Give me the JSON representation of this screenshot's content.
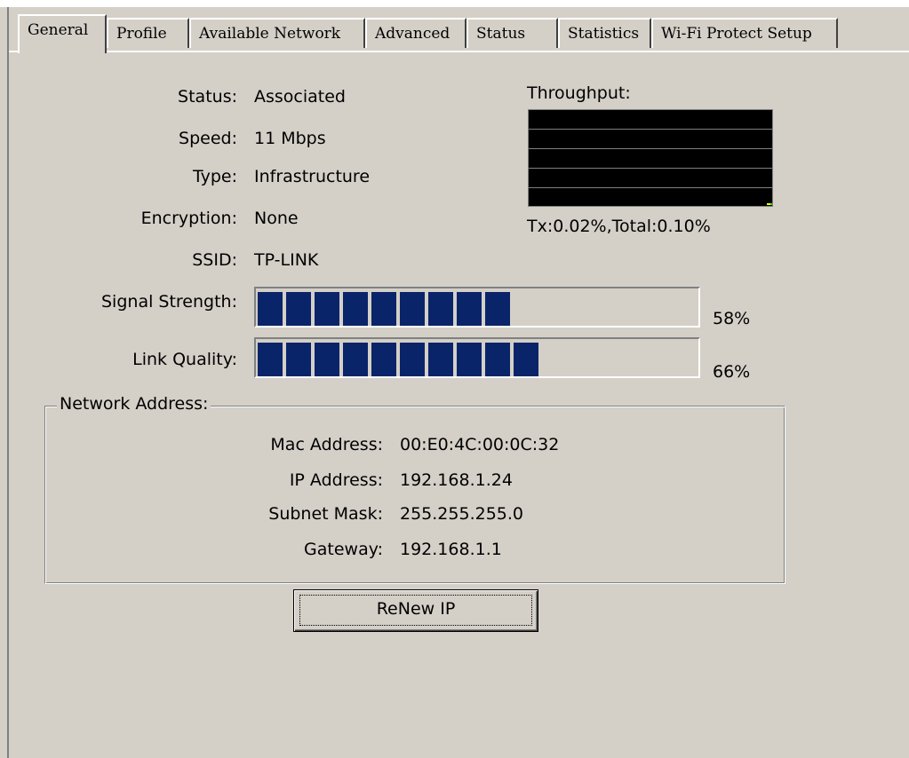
{
  "tabs": [
    {
      "label": "General",
      "active": true
    },
    {
      "label": "Profile",
      "active": false
    },
    {
      "label": "Available Network",
      "active": false
    },
    {
      "label": "Advanced",
      "active": false
    },
    {
      "label": "Status",
      "active": false
    },
    {
      "label": "Statistics",
      "active": false
    },
    {
      "label": "Wi-Fi Protect Setup",
      "active": false
    }
  ],
  "general": {
    "status": {
      "label": "Status:",
      "value": "Associated"
    },
    "speed": {
      "label": "Speed:",
      "value": "11 Mbps"
    },
    "type": {
      "label": "Type:",
      "value": "Infrastructure"
    },
    "encryption": {
      "label": "Encryption:",
      "value": "None"
    },
    "ssid": {
      "label": "SSID:",
      "value": "TP-LINK"
    }
  },
  "throughput": {
    "label": "Throughput:",
    "summary": "Tx:0.02%,Total:0.10%"
  },
  "signal_strength": {
    "label": "Signal Strength:",
    "percent_text": "58%",
    "level": 0.58,
    "bar_color": "#0a246a"
  },
  "link_quality": {
    "label": "Link Quality:",
    "percent_text": "66%",
    "level": 0.66,
    "bar_color": "#0a246a"
  },
  "network_address": {
    "legend": "Network Address:",
    "mac": {
      "label": "Mac Address:",
      "value": "00:E0:4C:00:0C:32"
    },
    "ip": {
      "label": "IP Address:",
      "value": "192.168.1.24"
    },
    "subnet": {
      "label": "Subnet Mask:",
      "value": "255.255.255.0"
    },
    "gateway": {
      "label": "Gateway:",
      "value": "192.168.1.1"
    }
  },
  "renew_button": {
    "label": "ReNew IP"
  }
}
